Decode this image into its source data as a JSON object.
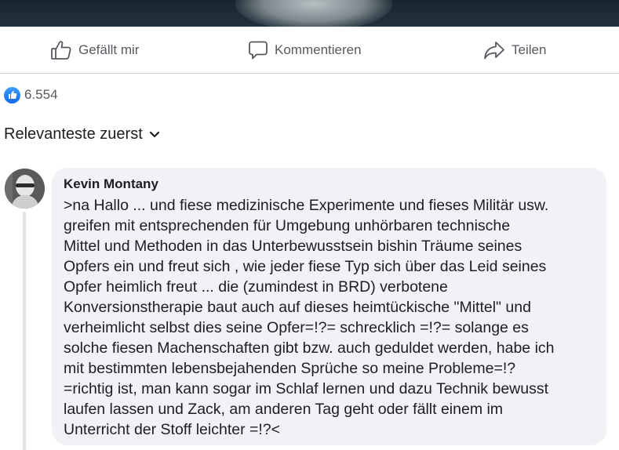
{
  "actions": {
    "like_label": "Gefällt mir",
    "comment_label": "Kommentieren",
    "share_label": "Teilen"
  },
  "reactions": {
    "count": "6.554",
    "icon": "thumbs-up-icon",
    "color": "#1877f2"
  },
  "sort": {
    "label": "Relevanteste zuerst",
    "icon": "chevron-down-icon"
  },
  "comment": {
    "author": "Kevin Montany",
    "text": ">na Hallo ... und fiese medizinische  Experimente und fieses Militär usw.\ngreifen mit entsprechenden  für Umgebung unhörbaren technische\nMittel und Methoden in das Unterbewusstsein bishin Träume seines\nOpfers  ein und freut sich , wie jeder fiese Typ sich über das Leid seines\nOpfer heimlich  freut ... die (zumindest in BRD) verbotene\nKonversionstherapie baut auch auf dieses heimtückische \"Mittel\" und\nverheimlicht selbst dies seine Opfer=!?= schrecklich =!?= solange es\nsolche fiesen Machenschaften gibt bzw. auch geduldet werden, habe ich\nmit bestimmten lebensbejahenden Sprüche so meine Probleme=!?\n=richtig ist, man kann sogar im Schlaf lernen und dazu Technik bewusst\nlaufen lassen und Zack, am anderen Tag geht oder fällt einem im\nUnterricht  der Stoff leichter =!?<"
  }
}
